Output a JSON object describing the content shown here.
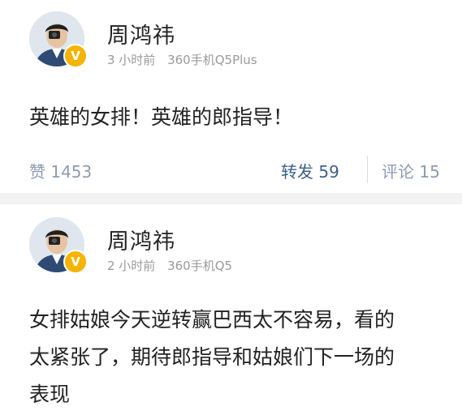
{
  "posts": [
    {
      "author": "周鸿祎",
      "time": "3 小时前",
      "device": "360手机Q5Plus",
      "badge": "V",
      "text": "英雄的女排！英雄的郎指导！",
      "actions": {
        "like": "赞 1453",
        "repost": "转发 59",
        "comment": "评论 15"
      }
    },
    {
      "author": "周鸿祎",
      "time": "2 小时前",
      "device": "360手机Q5",
      "badge": "V",
      "text_lines": [
        "女排姑娘今天逆转赢巴西太不容易，看的",
        "太紧张了，期待郎指导和姑娘们下一场的",
        "表现"
      ]
    }
  ],
  "colors": {
    "badge": "#f5b400",
    "action_text": "#8d9bb0",
    "repost_text": "#3d5f8a",
    "meta_text": "#9a9a9a"
  }
}
